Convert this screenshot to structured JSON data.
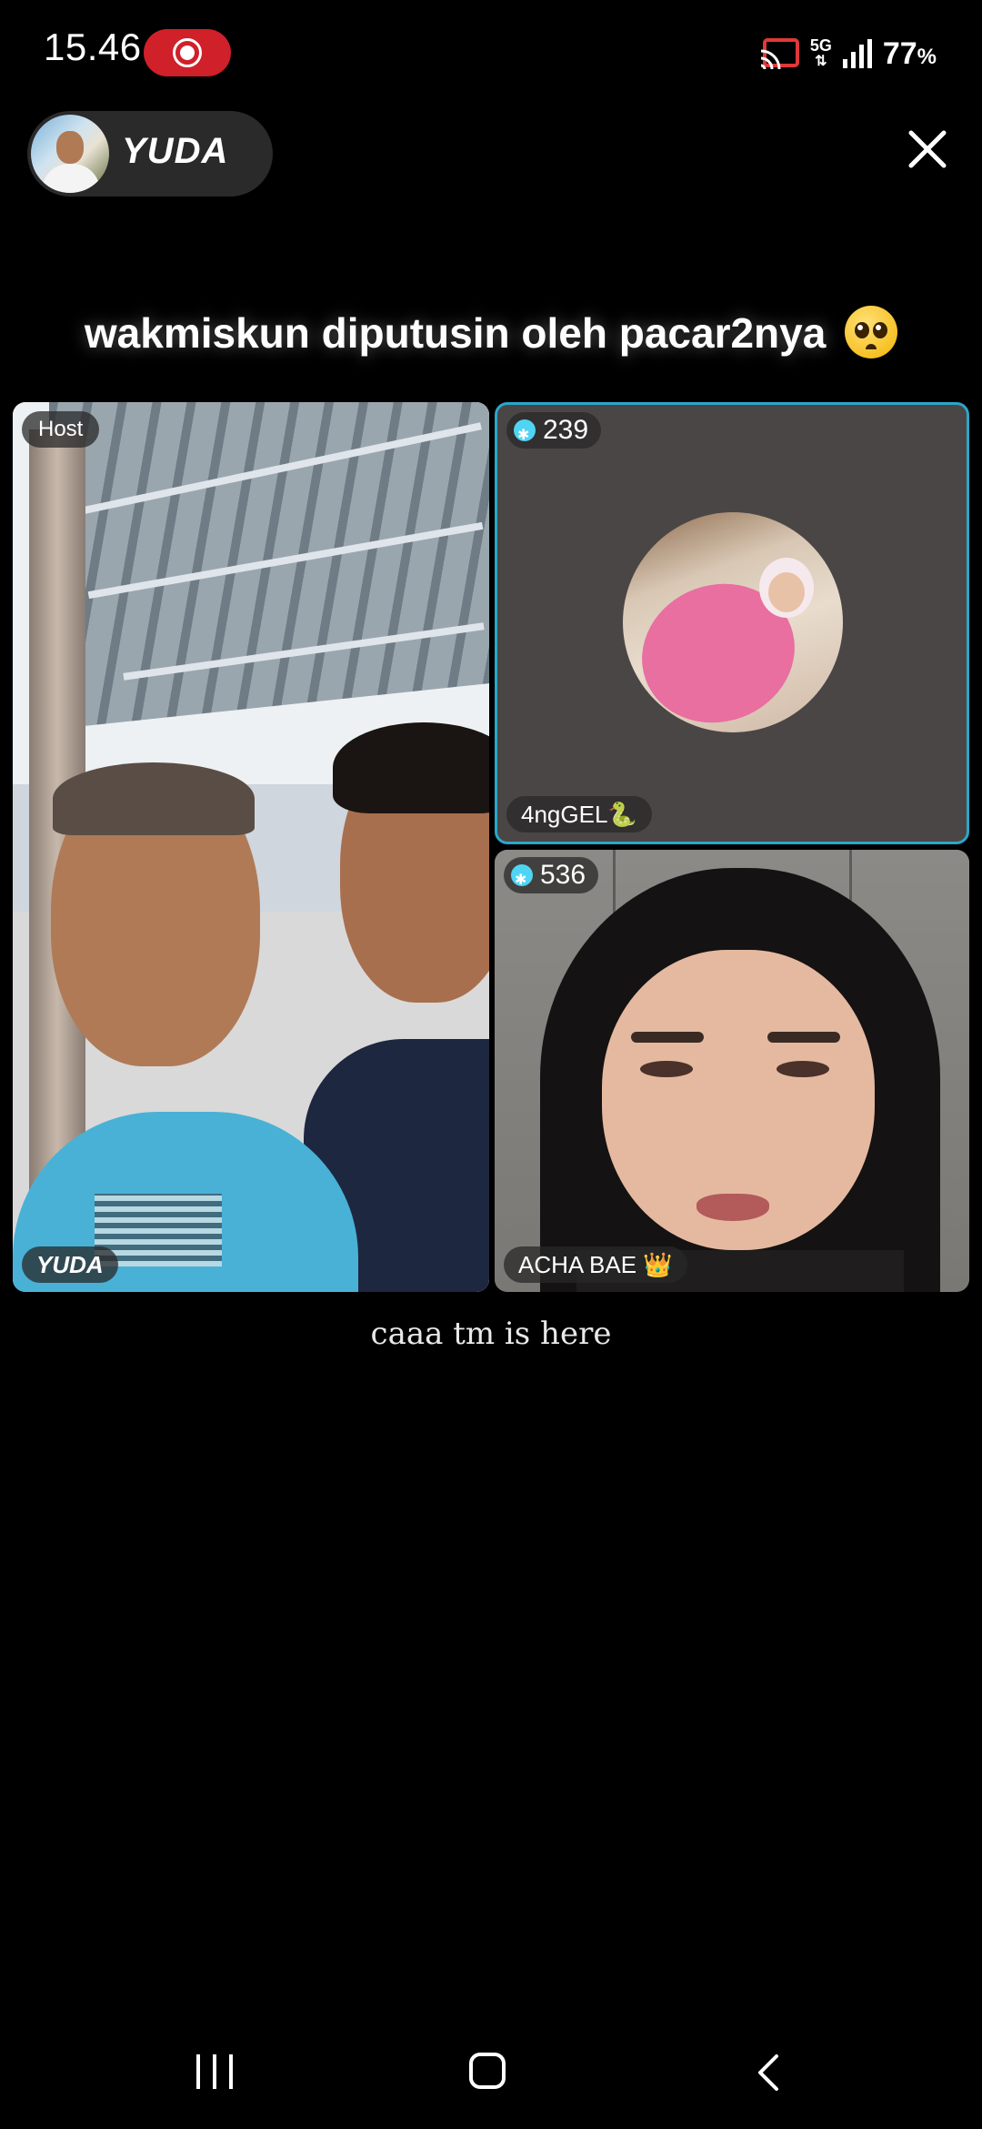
{
  "status_bar": {
    "time": "15.46",
    "network": "5G",
    "battery_value": "77",
    "battery_unit": "%"
  },
  "host": {
    "name": "YUDA"
  },
  "room": {
    "title": "wakmiskun diputusin oleh pacar2nya"
  },
  "tiles": {
    "host_tile": {
      "role_label": "Host",
      "name": "YUDA"
    },
    "guest_1": {
      "coins": "239",
      "name": "4ngGEL🐍"
    },
    "guest_2": {
      "coins": "536",
      "name": "ACHA BAE 👑"
    }
  },
  "caption": "caaa tm is here",
  "colors": {
    "background": "#000000",
    "record_pill": "#d0202a",
    "active_speaker_border": "#2aa7c9",
    "coin_icon": "#4fd4f4"
  },
  "icons": [
    "record-icon",
    "cast-icon",
    "signal-icon",
    "close-icon",
    "coin-icon",
    "recent-apps-icon",
    "home-icon",
    "back-icon"
  ]
}
